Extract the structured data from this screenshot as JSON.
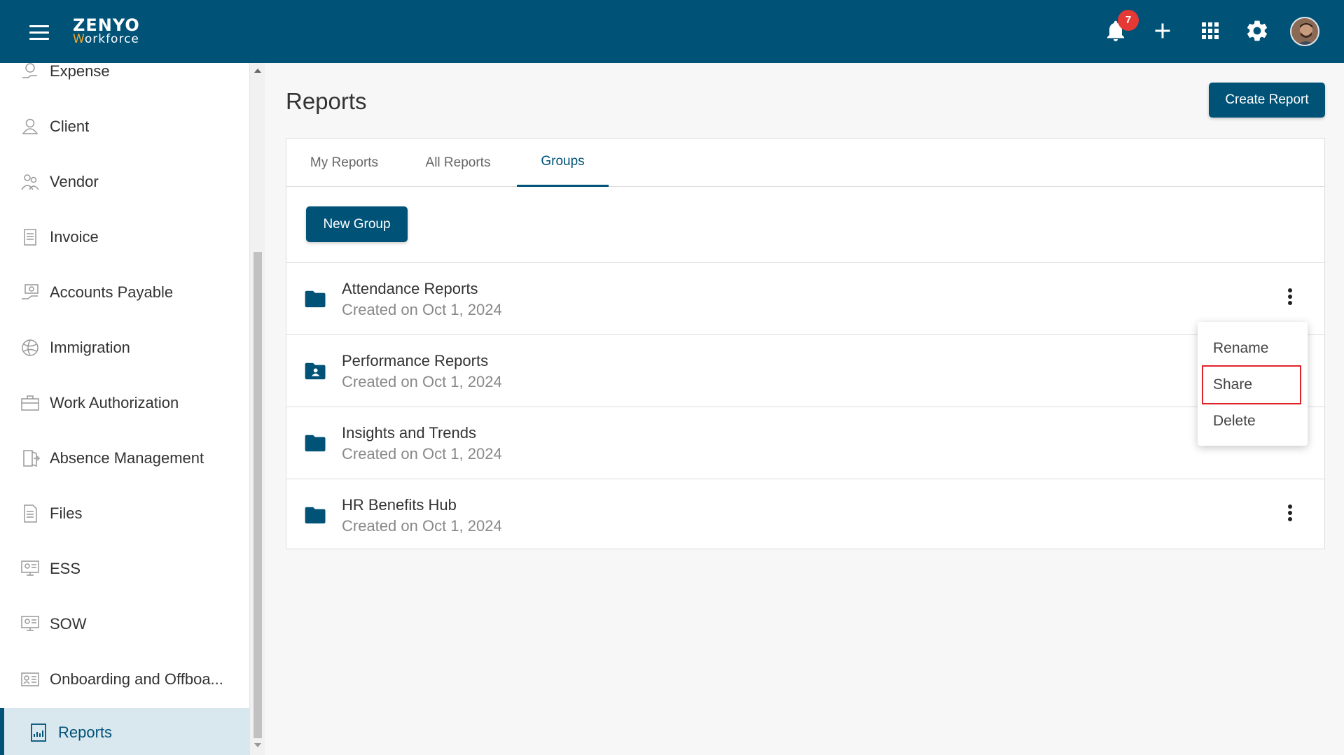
{
  "app": {
    "brand_top": "ZENYO",
    "brand_bottom_w": "W",
    "brand_bottom_rest": "orkforce",
    "primary_color": "#005277"
  },
  "header": {
    "notification_count": "7",
    "icons": [
      "menu-icon",
      "bell-icon",
      "plus-icon",
      "apps-grid-icon",
      "gear-icon",
      "avatar"
    ]
  },
  "sidebar": {
    "items": [
      {
        "label": "Expense",
        "icon": "expense-icon"
      },
      {
        "label": "Client",
        "icon": "user-icon"
      },
      {
        "label": "Vendor",
        "icon": "vendor-icon"
      },
      {
        "label": "Invoice",
        "icon": "invoice-icon"
      },
      {
        "label": "Accounts Payable",
        "icon": "accounts-payable-icon"
      },
      {
        "label": "Immigration",
        "icon": "globe-icon"
      },
      {
        "label": "Work Authorization",
        "icon": "briefcase-icon"
      },
      {
        "label": "Absence Management",
        "icon": "exit-door-icon"
      },
      {
        "label": "Files",
        "icon": "file-icon"
      },
      {
        "label": "ESS",
        "icon": "ess-icon"
      },
      {
        "label": "SOW",
        "icon": "sow-icon"
      },
      {
        "label": "Onboarding and Offboa...",
        "icon": "id-card-icon"
      },
      {
        "label": "Reports",
        "icon": "report-icon",
        "active": true
      }
    ]
  },
  "main": {
    "title": "Reports",
    "create_button": "Create Report",
    "tabs": [
      {
        "label": "My Reports"
      },
      {
        "label": "All Reports"
      },
      {
        "label": "Groups",
        "active": true
      }
    ],
    "new_group_button": "New Group",
    "groups": [
      {
        "name": "Attendance Reports",
        "created": "Created on Oct 1, 2024",
        "icon": "folder-icon"
      },
      {
        "name": "Performance Reports",
        "created": "Created on Oct 1, 2024",
        "icon": "folder-shared-icon"
      },
      {
        "name": "Insights and Trends",
        "created": "Created on Oct 1, 2024",
        "icon": "folder-icon"
      },
      {
        "name": "HR Benefits Hub",
        "created": "Created on Oct 1, 2024",
        "icon": "folder-icon"
      }
    ]
  },
  "context_menu": {
    "items": [
      {
        "label": "Rename"
      },
      {
        "label": "Share",
        "highlighted": true
      },
      {
        "label": "Delete"
      }
    ],
    "highlight_color": "#e0232b"
  }
}
